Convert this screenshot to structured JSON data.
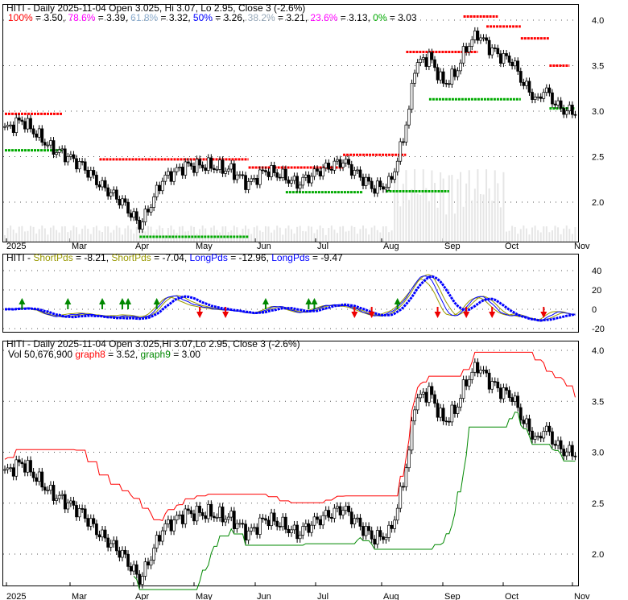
{
  "chart_data": [
    {
      "type": "line",
      "panel": "price",
      "title": "HITI - Daily 2025-11-04 Open 3.025, Hi 3.07, Lo 2.95, Close 3 (-2.6%)",
      "fib_levels": [
        {
          "label": "100%",
          "value": "3.50",
          "color": "#ff0000"
        },
        {
          "label": "78.6%",
          "value": "3.39",
          "color": "#ff00ff"
        },
        {
          "label": "61.8%",
          "value": "3.32",
          "color": "#88aacc"
        },
        {
          "label": "50%",
          "value": "3.26",
          "color": "#0000ff"
        },
        {
          "label": "38.2%",
          "value": "3.21",
          "color": "#99aabb"
        },
        {
          "label": "23.6%",
          "value": "3.13",
          "color": "#ff00ff"
        },
        {
          "label": "0%",
          "value": "3.03",
          "color": "#00aa00"
        }
      ],
      "yticks": [
        "4.0",
        "3.5",
        "3.0",
        "2.5",
        "2.0"
      ],
      "ylim": [
        1.55,
        4.15
      ],
      "xticks": [
        "2025",
        "Mar",
        "Apr",
        "May",
        "Jun",
        "Jul",
        "Aug",
        "Sep",
        "Oct",
        "Nov"
      ]
    },
    {
      "type": "line",
      "panel": "oscillator",
      "prefix": "HITI - ",
      "legend": [
        {
          "name": "ShortPds",
          "value": "-8.21",
          "color": "#999900"
        },
        {
          "name": "ShortPds",
          "value": "-7.04",
          "color": "#999900"
        },
        {
          "name": "LongPds",
          "value": "-12.96",
          "color": "#0000ff"
        },
        {
          "name": "LongPds",
          "value": "-9.47",
          "color": "#0000ff"
        }
      ],
      "yticks": [
        "40",
        "20",
        "0",
        "-20"
      ],
      "ylim": [
        -22,
        48
      ]
    },
    {
      "type": "line",
      "panel": "price-bands",
      "title": "HITI - Daily 2025-11-04 Open 3.025,Hi 3.07,Lo 2.95, Close 3 (-2.6%)",
      "volume": "Vol 50,676,900",
      "graph8": {
        "name": "graph8",
        "value": "3.52",
        "color": "#ff0000"
      },
      "graph9": {
        "name": "graph9",
        "value": "3.00",
        "color": "#008800"
      },
      "yticks": [
        "4.0",
        "3.5",
        "3.0",
        "2.5",
        "2.0"
      ],
      "ylim": [
        1.8,
        4.1
      ],
      "xticks": [
        "2025",
        "Mar",
        "Apr",
        "May",
        "Jun",
        "Jul",
        "Aug",
        "Sep",
        "Oct",
        "Nov"
      ]
    }
  ],
  "close_keypoints": {
    "day": [
      0,
      6,
      16,
      22,
      27,
      33,
      41,
      47,
      49,
      55,
      63,
      71,
      79,
      85,
      91,
      96,
      102,
      110,
      118,
      125,
      129,
      134,
      137,
      141,
      143,
      148,
      153,
      157,
      161,
      165,
      169,
      173,
      177,
      181,
      186,
      188,
      193,
      196,
      199
    ],
    "close": [
      2.8,
      2.9,
      2.6,
      2.5,
      2.4,
      2.2,
      2.0,
      1.75,
      1.85,
      2.25,
      2.4,
      2.4,
      2.35,
      2.2,
      2.35,
      2.3,
      2.2,
      2.35,
      2.45,
      2.25,
      2.15,
      2.2,
      2.45,
      3.0,
      3.5,
      3.6,
      3.3,
      3.4,
      3.7,
      3.85,
      3.7,
      3.6,
      3.55,
      3.3,
      3.1,
      3.25,
      3.05,
      3.0,
      3.0
    ]
  }
}
